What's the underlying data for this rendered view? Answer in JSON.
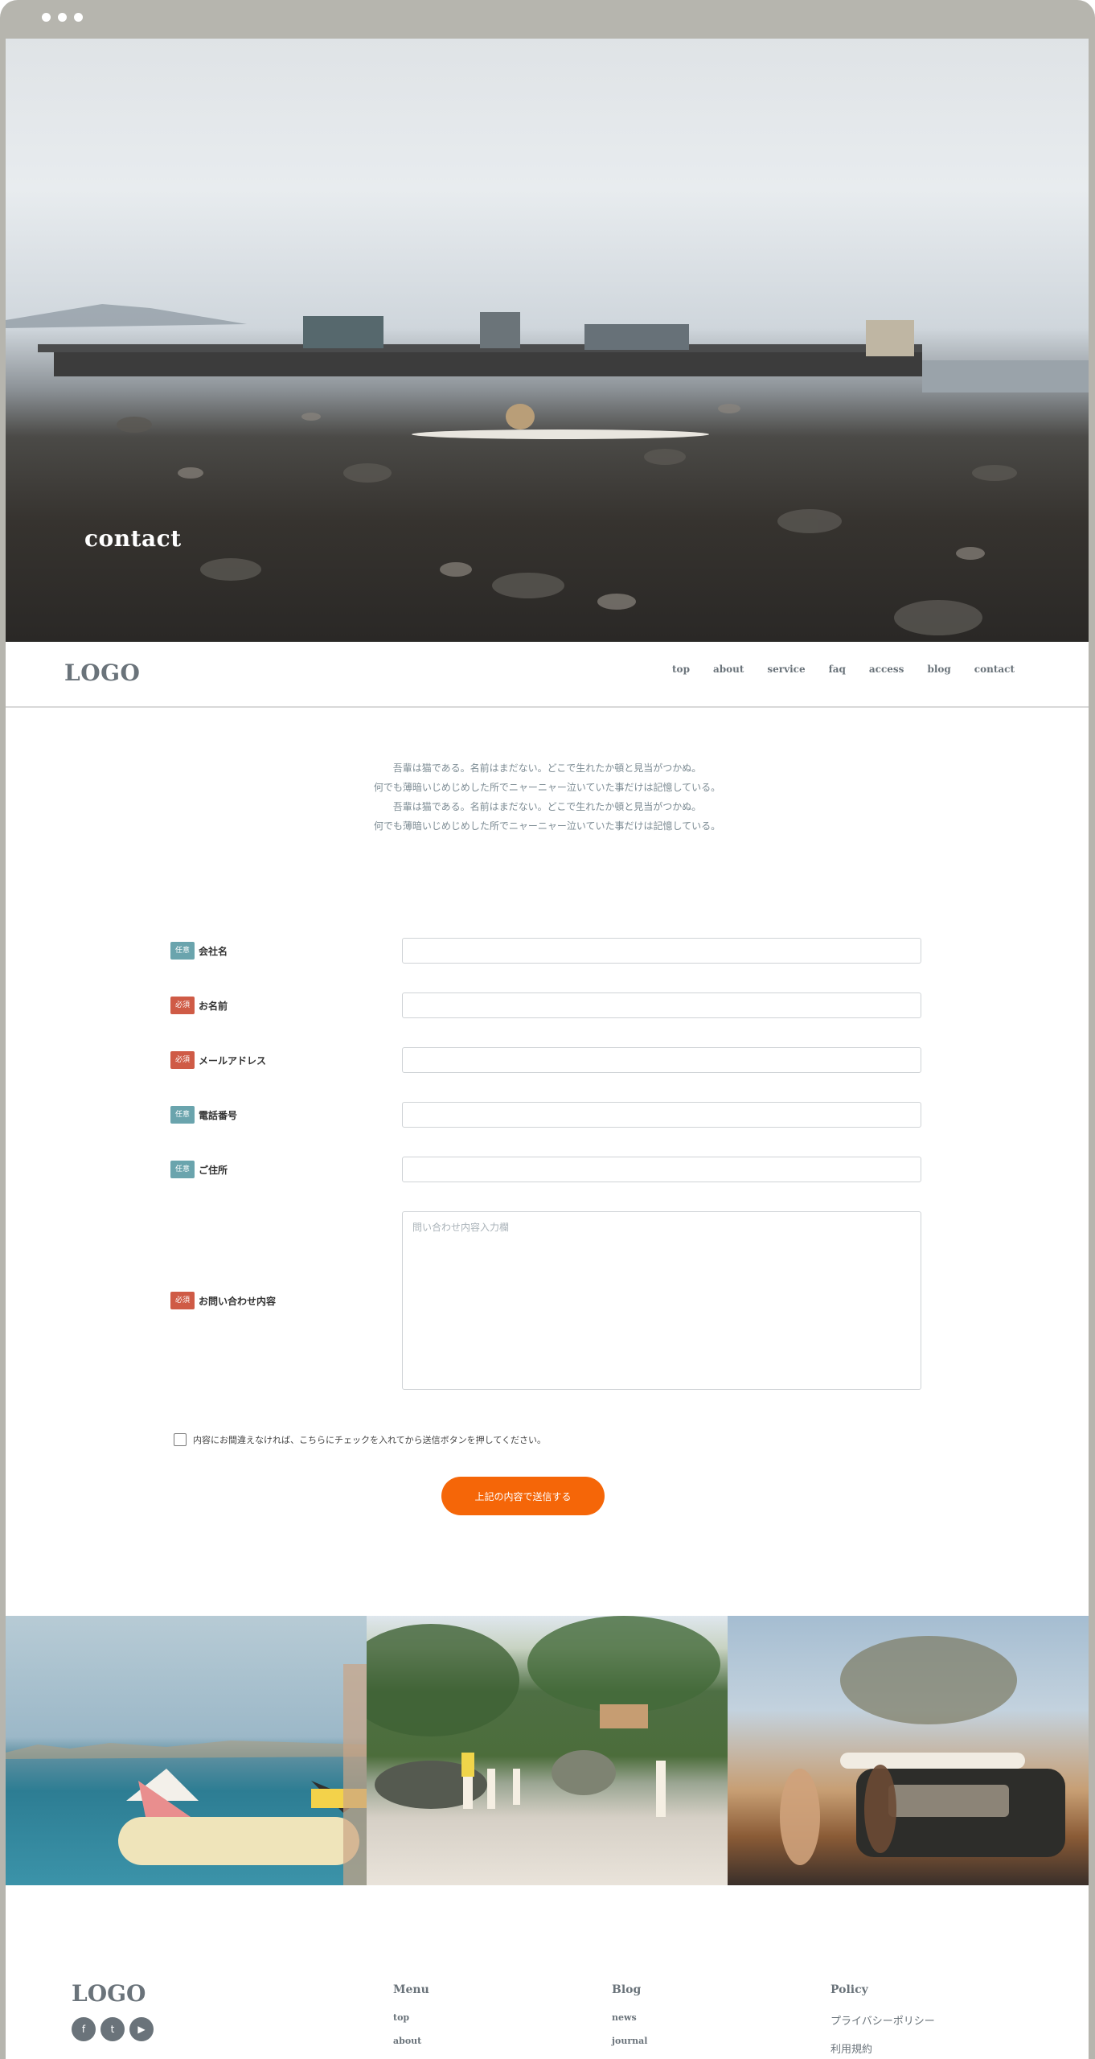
{
  "hero": {
    "title": "contact"
  },
  "header": {
    "logo": "LOGO",
    "nav": [
      "top",
      "about",
      "service",
      "faq",
      "access",
      "blog",
      "contact"
    ]
  },
  "intro": {
    "lines": [
      "吾輩は猫である。名前はまだない。どこで生れたか頓と見当がつかぬ。",
      "何でも薄暗いじめじめした所でニャーニャー泣いていた事だけは記憶している。",
      "吾輩は猫である。名前はまだない。どこで生れたか頓と見当がつかぬ。",
      "何でも薄暗いじめじめした所でニャーニャー泣いていた事だけは記憶している。"
    ]
  },
  "form": {
    "fields": [
      {
        "badge": "任意",
        "label": "会社名",
        "value": ""
      },
      {
        "badge": "必須",
        "label": "お名前",
        "value": ""
      },
      {
        "badge": "必須",
        "label": "メールアドレス",
        "value": ""
      },
      {
        "badge": "任意",
        "label": "電話番号",
        "value": ""
      },
      {
        "badge": "任意",
        "label": "ご住所",
        "value": ""
      }
    ],
    "message": {
      "badge": "必須",
      "label": "お問い合わせ内容",
      "placeholder": "問い合わせ内容入力欄"
    },
    "consent_text": "内容にお間違えなければ、こちらにチェックを入れてから送信ボタンを押してください。",
    "consent_checked": false,
    "submit_label": "上記の内容で送信する",
    "colors": {
      "optional_badge": "#6aa4ad",
      "required_badge": "#cf5b46",
      "submit": "#f56608"
    }
  },
  "footer": {
    "logo": "LOGO",
    "social": [
      "facebook-icon",
      "twitter-icon",
      "youtube-icon"
    ],
    "menu": {
      "title": "Menu",
      "items": [
        "top",
        "about"
      ]
    },
    "blog": {
      "title": "Blog",
      "items": [
        "news",
        "journal"
      ]
    },
    "policy": {
      "title": "Policy",
      "items": [
        "プライバシーポリシー",
        "利用規約"
      ]
    }
  }
}
